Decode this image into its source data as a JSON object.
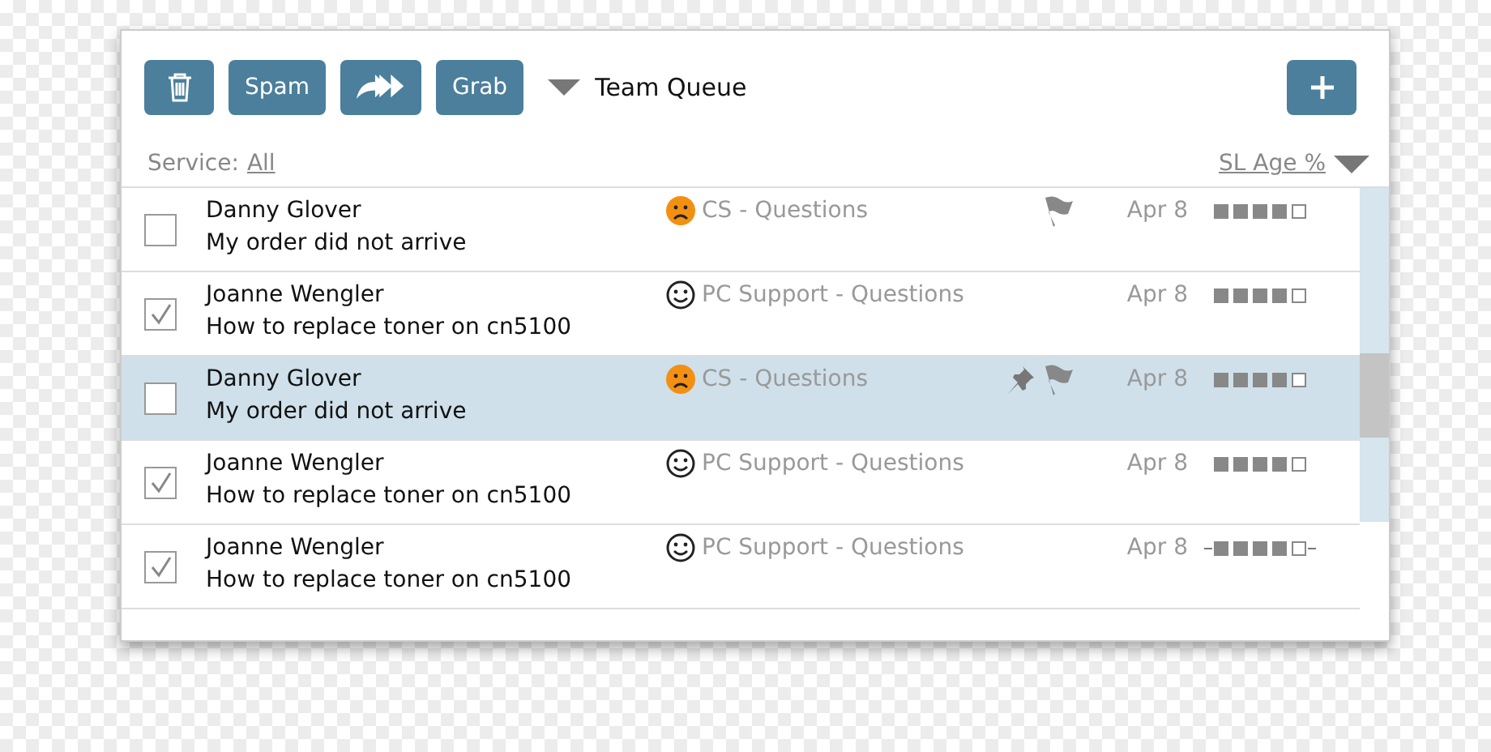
{
  "toolbar": {
    "buttons": [
      {
        "kind": "trash"
      },
      {
        "kind": "text",
        "label": "Spam"
      },
      {
        "kind": "forward"
      },
      {
        "kind": "text",
        "label": "Grab"
      }
    ],
    "queue": "Team Queue",
    "add_button": {
      "kind": "plus"
    }
  },
  "filter": {
    "label": "Service:",
    "value": "All",
    "sort": "SL Age %"
  },
  "rows": [
    {
      "checked": false,
      "selected": false,
      "name": "Danny Glover",
      "subject": "My order did not arrive",
      "kind": "sad",
      "service": "CS - Questions",
      "pinned": false,
      "flagged": true,
      "date": "Apr 8",
      "stars": 4,
      "struck": false
    },
    {
      "checked": true,
      "selected": false,
      "name": "Joanne Wengler",
      "subject": "How to replace toner on cn5100",
      "kind": "happy",
      "service": "PC Support - Questions",
      "pinned": false,
      "flagged": false,
      "date": "Apr 8",
      "stars": 4,
      "struck": false
    },
    {
      "checked": false,
      "selected": true,
      "name": "Danny Glover",
      "subject": "My order did not arrive",
      "kind": "sad",
      "service": "CS - Questions",
      "pinned": true,
      "flagged": true,
      "date": "Apr 8",
      "stars": 4,
      "struck": false
    },
    {
      "checked": true,
      "selected": false,
      "name": "Joanne Wengler",
      "subject": "How to replace toner on cn5100",
      "kind": "happy",
      "service": "PC Support - Questions",
      "pinned": false,
      "flagged": false,
      "date": "Apr 8",
      "stars": 4,
      "struck": false
    },
    {
      "checked": true,
      "selected": false,
      "name": "Joanne Wengler",
      "subject": "How to replace toner on cn5100",
      "kind": "happy",
      "service": "PC Support - Questions",
      "pinned": false,
      "flagged": false,
      "date": "Apr 8",
      "stars": 4,
      "struck": true
    }
  ]
}
